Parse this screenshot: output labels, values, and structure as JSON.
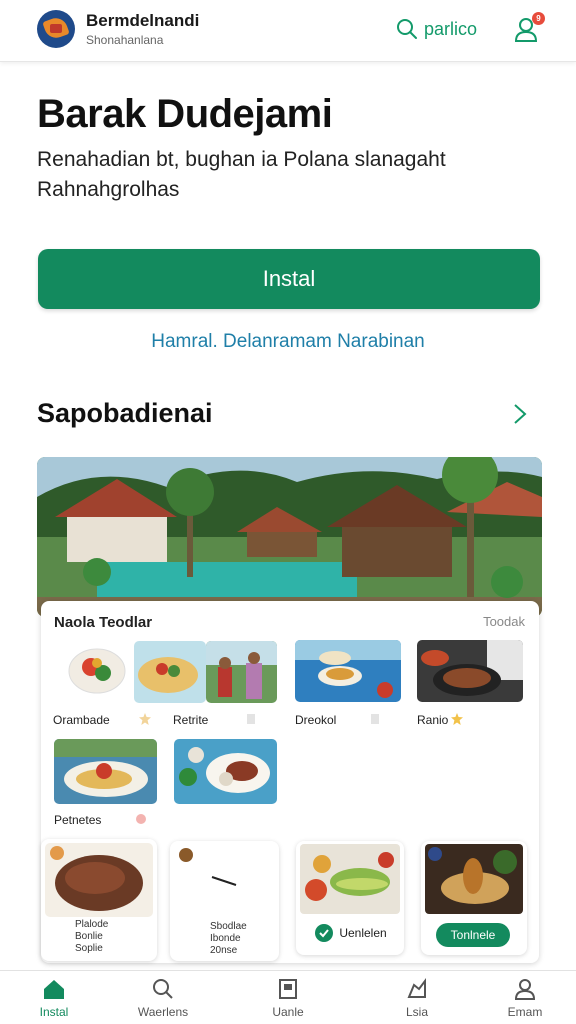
{
  "header": {
    "app_title": "Bermdelnandi",
    "app_subtitle": "Shonahanlana",
    "search_label": "parlico",
    "notification_count": "9"
  },
  "hero": {
    "title": "Barak Dudejami",
    "description": "Renahadian bt, bughan ia Polana slanagaht Rahnahgrolhas",
    "install_label": "Instal",
    "more_link": "Hamral. Delanramam Narabinan"
  },
  "section": {
    "title": "Sapobadienai"
  },
  "card": {
    "title": "Naola Teodlar",
    "link": "Toodak",
    "tiles": [
      {
        "label": "Orambade"
      },
      {
        "label": "Retrite"
      },
      {
        "label": "Dreokol"
      },
      {
        "label": "Ranio"
      },
      {
        "label": "Petnetes"
      }
    ],
    "bottom_cards": [
      {
        "line1": "Plalode",
        "line2": "Bonlie",
        "line3": "Soplie"
      },
      {
        "line1": "Sbodlae",
        "line2": "Ibonde",
        "line3": "20nse"
      },
      {
        "button": "Uenlelen"
      },
      {
        "button": "Tonlnele"
      }
    ]
  },
  "nav": {
    "items": [
      {
        "label": "Instal"
      },
      {
        "label": "Waerlens"
      },
      {
        "label": "Uanle"
      },
      {
        "label": "Lsia"
      },
      {
        "label": "Emam"
      }
    ]
  },
  "colors": {
    "accent": "#138a5e",
    "link": "#1f7fa8",
    "badge": "#e74c3c"
  }
}
